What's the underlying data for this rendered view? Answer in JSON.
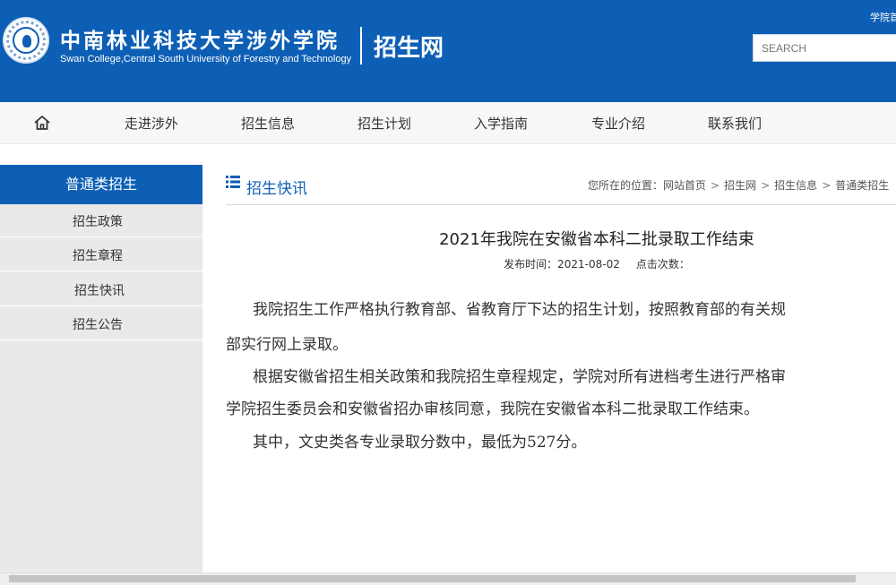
{
  "header": {
    "school_name_cn": "中南林业科技大学涉外学院",
    "school_name_en": "Swan College,Central South University of Forestry and Technology",
    "site_name": "招生网",
    "top_link": "学院首",
    "search_placeholder": "SEARCH"
  },
  "nav": {
    "items": [
      {
        "label": "走进涉外"
      },
      {
        "label": "招生信息"
      },
      {
        "label": "招生计划"
      },
      {
        "label": "入学指南"
      },
      {
        "label": "专业介绍"
      },
      {
        "label": "联系我们"
      }
    ]
  },
  "sidebar": {
    "title": "普通类招生",
    "items": [
      {
        "label": "招生政策"
      },
      {
        "label": "招生章程"
      },
      {
        "label": "招生快讯"
      },
      {
        "label": "招生公告"
      }
    ]
  },
  "section": {
    "title": "招生快讯",
    "breadcrumb": {
      "prefix": "您所在的位置：",
      "links": [
        "网站首页",
        "招生网",
        "招生信息",
        "普通类招生"
      ],
      "separator": ">"
    }
  },
  "article": {
    "title": "2021年我院在安徽省本科二批录取工作结束",
    "publish_label": "发布时间：2021-08-02",
    "views_label": "点击次数：",
    "paragraphs": [
      "我院招生工作严格执行教育部、省教育厅下达的招生计划，按照教育部的有关规",
      "部实行网上录取。",
      "根据安徽省招生相关政策和我院招生章程规定，学院对所有进档考生进行严格审",
      "学院招生委员会和安徽省招办审核同意，我院在安徽省本科二批录取工作结束。",
      "其中，文史类各专业录取分数中，最低为527分。"
    ]
  },
  "colors": {
    "brand_blue": "#0d5fb5",
    "nav_bg": "#f7f7f7",
    "sidebar_bg": "#e9e9e9"
  },
  "icons": [
    "school-logo-icon",
    "home-icon",
    "list-icon"
  ]
}
